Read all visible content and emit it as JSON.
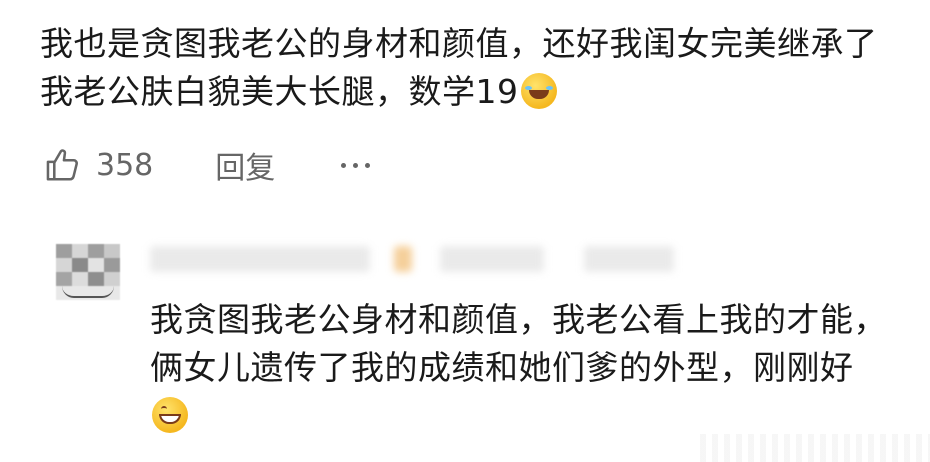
{
  "comment": {
    "text": "我也是贪图我老公的身材和颜值，还好我闺女完美继承了我老公肤白貌美大长腿，数学19",
    "emoji": "laughing-tears-emoji"
  },
  "actions": {
    "like_count": "358",
    "reply_label": "回复",
    "like_icon": "thumbs-up-icon",
    "more_icon": "more-dots-icon"
  },
  "reply": {
    "text": "我贪图我老公身材和颜值，我老公看上我的才能，俩女儿遗传了我的成绩和她们爹的外型，刚刚好",
    "emoji": "grinning-emoji"
  },
  "colors": {
    "text": "#1a1a1a",
    "secondary": "#666666",
    "background": "#ffffff"
  }
}
